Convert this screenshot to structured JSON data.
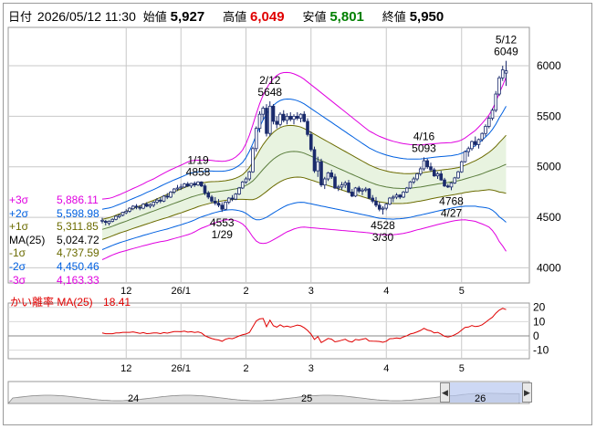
{
  "header": {
    "date_label": "日付",
    "datetime": "2026/05/12 11:30",
    "open_label": "始値",
    "open_value": "5,927",
    "high_label": "高値",
    "high_value": "6,049",
    "low_label": "安値",
    "low_value": "5,801",
    "close_label": "終値",
    "close_value": "5,950",
    "colors": {
      "high": "#e00000",
      "low": "#008000",
      "text": "#000000"
    }
  },
  "bb_legend": [
    {
      "label": "+3σ",
      "value": "5,886.11",
      "color": "#e000e0"
    },
    {
      "label": "+2σ",
      "value": "5,598.98",
      "color": "#0060e0"
    },
    {
      "label": "+1σ",
      "value": "5,311.85",
      "color": "#6b6b00"
    },
    {
      "label": "MA(25)",
      "value": "5,024.72",
      "color": "#000000"
    },
    {
      "label": "-1σ",
      "value": "4,737.59",
      "color": "#6b6b00"
    },
    {
      "label": "-2σ",
      "value": "4,450.46",
      "color": "#0060e0"
    },
    {
      "label": "-3σ",
      "value": "4,163.33",
      "color": "#e000e0"
    }
  ],
  "divergence": {
    "label": "かい離率 MA(25)",
    "value": "18.41",
    "color": "#e00000"
  },
  "navigator_icons": [
    "scroll-left-icon",
    "scroll-right-icon"
  ],
  "chart_data": [
    {
      "type": "candlestick",
      "title": "",
      "y_ticks": [
        4000,
        4500,
        5000,
        5500,
        6000
      ],
      "ylim": [
        3850,
        6380
      ],
      "x_tick_labels": [
        "12",
        "26/1",
        "2",
        "3",
        "4",
        "5"
      ],
      "x_tick_bar_index": [
        7,
        23,
        42,
        61,
        83,
        105
      ],
      "grid": true,
      "annotations": [
        {
          "text": "1/19",
          "value": 4858,
          "bar": 28,
          "position": "above"
        },
        {
          "text": "4553 1/29",
          "value": 4553,
          "bar": 35,
          "position": "below"
        },
        {
          "text": "2/12",
          "value": 5648,
          "bar": 49,
          "position": "above"
        },
        {
          "text": "4528 3/30",
          "value": 4528,
          "bar": 82,
          "position": "below"
        },
        {
          "text": "4/16",
          "value": 5093,
          "bar": 94,
          "position": "above"
        },
        {
          "text": "4768 4/27",
          "value": 4768,
          "bar": 102,
          "position": "below"
        },
        {
          "text": "5/12",
          "value": 6049,
          "bar": 118,
          "position": "above"
        }
      ],
      "ohlc": [
        [
          4470,
          4495,
          4440,
          4470
        ],
        [
          4460,
          4475,
          4420,
          4450
        ],
        [
          4440,
          4470,
          4420,
          4460
        ],
        [
          4460,
          4490,
          4450,
          4480
        ],
        [
          4480,
          4520,
          4470,
          4510
        ],
        [
          4505,
          4530,
          4490,
          4520
        ],
        [
          4520,
          4555,
          4510,
          4550
        ],
        [
          4545,
          4580,
          4530,
          4560
        ],
        [
          4560,
          4600,
          4545,
          4590
        ],
        [
          4585,
          4620,
          4570,
          4610
        ],
        [
          4610,
          4630,
          4580,
          4600
        ],
        [
          4600,
          4620,
          4570,
          4590
        ],
        [
          4590,
          4640,
          4580,
          4630
        ],
        [
          4630,
          4650,
          4600,
          4610
        ],
        [
          4610,
          4640,
          4590,
          4625
        ],
        [
          4620,
          4660,
          4600,
          4650
        ],
        [
          4650,
          4690,
          4630,
          4670
        ],
        [
          4670,
          4700,
          4640,
          4660
        ],
        [
          4660,
          4720,
          4650,
          4710
        ],
        [
          4710,
          4740,
          4680,
          4700
        ],
        [
          4700,
          4760,
          4690,
          4750
        ],
        [
          4750,
          4790,
          4730,
          4780
        ],
        [
          4780,
          4820,
          4760,
          4790
        ],
        [
          4790,
          4830,
          4770,
          4800
        ],
        [
          4800,
          4840,
          4790,
          4830
        ],
        [
          4830,
          4850,
          4800,
          4810
        ],
        [
          4810,
          4840,
          4790,
          4835
        ],
        [
          4835,
          4855,
          4800,
          4820
        ],
        [
          4820,
          4858,
          4810,
          4850
        ],
        [
          4850,
          4856,
          4800,
          4810
        ],
        [
          4810,
          4830,
          4720,
          4740
        ],
        [
          4740,
          4760,
          4680,
          4700
        ],
        [
          4700,
          4720,
          4640,
          4660
        ],
        [
          4660,
          4700,
          4620,
          4640
        ],
        [
          4640,
          4680,
          4600,
          4620
        ],
        [
          4620,
          4650,
          4553,
          4580
        ],
        [
          4580,
          4660,
          4570,
          4650
        ],
        [
          4650,
          4700,
          4630,
          4690
        ],
        [
          4690,
          4720,
          4660,
          4680
        ],
        [
          4680,
          4740,
          4670,
          4730
        ],
        [
          4730,
          4800,
          4720,
          4790
        ],
        [
          4790,
          4860,
          4780,
          4850
        ],
        [
          4850,
          4900,
          4830,
          4880
        ],
        [
          4880,
          4960,
          4860,
          4950
        ],
        [
          4950,
          5200,
          4940,
          5180
        ],
        [
          5180,
          5400,
          5150,
          5380
        ],
        [
          5380,
          5550,
          5340,
          5520
        ],
        [
          5520,
          5600,
          5460,
          5580
        ],
        [
          5580,
          5620,
          5300,
          5330
        ],
        [
          5330,
          5648,
          5300,
          5600
        ],
        [
          5600,
          5620,
          5420,
          5450
        ],
        [
          5450,
          5500,
          5380,
          5420
        ],
        [
          5420,
          5540,
          5400,
          5520
        ],
        [
          5520,
          5560,
          5440,
          5460
        ],
        [
          5460,
          5530,
          5420,
          5500
        ],
        [
          5500,
          5540,
          5450,
          5470
        ],
        [
          5470,
          5520,
          5420,
          5500
        ],
        [
          5500,
          5540,
          5460,
          5480
        ],
        [
          5480,
          5530,
          5440,
          5520
        ],
        [
          5520,
          5550,
          5440,
          5450
        ],
        [
          5450,
          5480,
          5300,
          5320
        ],
        [
          5320,
          5350,
          5150,
          5170
        ],
        [
          5170,
          5200,
          4940,
          4960
        ],
        [
          4960,
          5100,
          4900,
          5050
        ],
        [
          5050,
          5080,
          4800,
          4820
        ],
        [
          4820,
          4900,
          4780,
          4880
        ],
        [
          4880,
          4950,
          4860,
          4940
        ],
        [
          4940,
          4970,
          4880,
          4900
        ],
        [
          4900,
          4930,
          4780,
          4790
        ],
        [
          4790,
          4820,
          4760,
          4800
        ],
        [
          4800,
          4850,
          4770,
          4820
        ],
        [
          4820,
          4860,
          4790,
          4840
        ],
        [
          4840,
          4870,
          4740,
          4750
        ],
        [
          4750,
          4780,
          4700,
          4710
        ],
        [
          4710,
          4800,
          4700,
          4790
        ],
        [
          4790,
          4810,
          4740,
          4760
        ],
        [
          4760,
          4790,
          4720,
          4770
        ],
        [
          4770,
          4800,
          4750,
          4780
        ],
        [
          4780,
          4790,
          4680,
          4690
        ],
        [
          4690,
          4720,
          4640,
          4660
        ],
        [
          4660,
          4700,
          4600,
          4620
        ],
        [
          4620,
          4650,
          4560,
          4580
        ],
        [
          4580,
          4610,
          4528,
          4590
        ],
        [
          4590,
          4640,
          4570,
          4630
        ],
        [
          4630,
          4700,
          4620,
          4690
        ],
        [
          4690,
          4720,
          4650,
          4700
        ],
        [
          4700,
          4740,
          4680,
          4720
        ],
        [
          4720,
          4730,
          4680,
          4700
        ],
        [
          4700,
          4760,
          4690,
          4750
        ],
        [
          4750,
          4800,
          4740,
          4790
        ],
        [
          4790,
          4860,
          4780,
          4850
        ],
        [
          4850,
          4900,
          4830,
          4880
        ],
        [
          4880,
          4940,
          4860,
          4930
        ],
        [
          4930,
          5000,
          4910,
          4980
        ],
        [
          4980,
          5093,
          4960,
          5060
        ],
        [
          5060,
          5080,
          4980,
          5000
        ],
        [
          5000,
          5040,
          4950,
          4970
        ],
        [
          4970,
          4990,
          4900,
          4910
        ],
        [
          4910,
          4950,
          4880,
          4930
        ],
        [
          4930,
          4960,
          4860,
          4870
        ],
        [
          4870,
          4890,
          4800,
          4810
        ],
        [
          4810,
          4830,
          4790,
          4800
        ],
        [
          4800,
          4850,
          4768,
          4840
        ],
        [
          4840,
          4900,
          4830,
          4890
        ],
        [
          4890,
          4960,
          4880,
          4950
        ],
        [
          4950,
          5060,
          4940,
          5050
        ],
        [
          5050,
          5160,
          5040,
          5150
        ],
        [
          5150,
          5200,
          5100,
          5180
        ],
        [
          5180,
          5260,
          5160,
          5250
        ],
        [
          5250,
          5300,
          5200,
          5220
        ],
        [
          5220,
          5280,
          5180,
          5270
        ],
        [
          5270,
          5340,
          5250,
          5330
        ],
        [
          5330,
          5420,
          5300,
          5400
        ],
        [
          5400,
          5500,
          5380,
          5480
        ],
        [
          5480,
          5580,
          5460,
          5560
        ],
        [
          5560,
          5750,
          5540,
          5720
        ],
        [
          5720,
          5900,
          5700,
          5880
        ],
        [
          5880,
          6000,
          5850,
          5960
        ],
        [
          5927,
          6049,
          5801,
          5950
        ]
      ],
      "bollinger": {
        "ma25": [
          4380,
          4390,
          4400,
          4412,
          4425,
          4438,
          4450,
          4462,
          4475,
          4488,
          4500,
          4512,
          4525,
          4538,
          4550,
          4562,
          4575,
          4588,
          4600,
          4612,
          4625,
          4638,
          4650,
          4662,
          4675,
          4688,
          4700,
          4710,
          4720,
          4728,
          4735,
          4742,
          4748,
          4752,
          4756,
          4760,
          4765,
          4770,
          4776,
          4782,
          4790,
          4800,
          4815,
          4835,
          4860,
          4895,
          4935,
          4975,
          5010,
          5045,
          5075,
          5100,
          5120,
          5135,
          5145,
          5150,
          5152,
          5150,
          5145,
          5135,
          5120,
          5105,
          5090,
          5075,
          5060,
          5045,
          5030,
          5015,
          5000,
          4985,
          4970,
          4955,
          4940,
          4925,
          4910,
          4895,
          4880,
          4865,
          4850,
          4838,
          4825,
          4815,
          4808,
          4800,
          4795,
          4790,
          4788,
          4786,
          4785,
          4786,
          4788,
          4792,
          4796,
          4800,
          4806,
          4812,
          4818,
          4824,
          4830,
          4835,
          4840,
          4845,
          4850,
          4856,
          4862,
          4870,
          4880,
          4890,
          4900,
          4910,
          4920,
          4932,
          4945,
          4958,
          4970,
          4982,
          4995,
          5010,
          5024.72
        ],
        "sd": [
          100,
          98,
          96,
          95,
          95,
          95,
          96,
          97,
          98,
          99,
          100,
          101,
          102,
          104,
          105,
          106,
          108,
          110,
          112,
          114,
          115,
          116,
          117,
          118,
          119,
          120,
          120,
          118,
          115,
          112,
          110,
          108,
          105,
          102,
          100,
          98,
          97,
          98,
          100,
          105,
          112,
          122,
          138,
          160,
          185,
          210,
          230,
          245,
          255,
          262,
          266,
          268,
          268,
          266,
          263,
          260,
          256,
          252,
          248,
          244,
          240,
          236,
          232,
          228,
          224,
          220,
          216,
          212,
          208,
          204,
          200,
          196,
          192,
          188,
          184,
          180,
          176,
          172,
          168,
          166,
          164,
          162,
          160,
          158,
          156,
          154,
          152,
          150,
          148,
          146,
          144,
          142,
          140,
          139,
          138,
          137,
          136,
          135,
          134,
          133,
          132,
          131,
          130,
          130,
          130,
          132,
          135,
          140,
          145,
          150,
          158,
          166,
          175,
          185,
          200,
          220,
          245,
          265,
          287.13
        ]
      }
    },
    {
      "type": "line",
      "title": "かい離率 MA(25)",
      "y_ticks": [
        -10,
        0,
        10,
        20
      ],
      "ylim": [
        -16,
        23
      ],
      "zero_line": true,
      "series": [
        {
          "name": "かい離率",
          "color": "#e00000",
          "values": [
            2,
            1.5,
            1.5,
            1.5,
            2,
            2,
            2.5,
            2.5,
            2.5,
            2.8,
            2.3,
            1.8,
            2.3,
            1.6,
            1.7,
            2,
            2.1,
            1.6,
            2.3,
            1.9,
            2.5,
            3,
            3,
            2.9,
            3.3,
            2.6,
            2.9,
            2.4,
            2.8,
            2,
            0.1,
            -1,
            -1.9,
            -2.5,
            -2.9,
            -3.8,
            -2.4,
            -1.7,
            -2,
            -1.1,
            0,
            0.8,
            1.3,
            2.4,
            6.4,
            10.5,
            11.9,
            12.2,
            6.4,
            11,
            7.1,
            6.1,
            7.8,
            6.3,
            6.8,
            6.2,
            6.8,
            7.6,
            7.1,
            5.7,
            3.8,
            1.2,
            -2.5,
            -0.5,
            -4.7,
            -3.3,
            -1.8,
            -2.3,
            -4.2,
            -3.7,
            -3,
            -2.4,
            -3.8,
            -4.3,
            -2.5,
            -2.9,
            -2.3,
            -1.8,
            -3.6,
            -3.7,
            -3.8,
            -3.9,
            -4.5,
            -3.7,
            -2,
            -1.9,
            -1.4,
            -1.8,
            -0.7,
            0.1,
            1.3,
            1.9,
            2.8,
            3.8,
            5.3,
            4.1,
            3.5,
            2.1,
            2.5,
            1.2,
            -0.3,
            -0.8,
            -0.2,
            0.8,
            2.1,
            4.1,
            5.9,
            6.2,
            7.3,
            6.5,
            6.8,
            7.8,
            9.5,
            11.4,
            13,
            15.9,
            18,
            19.3,
            18.41
          ]
        }
      ]
    },
    {
      "type": "area",
      "title": "",
      "x_tick_labels": [
        "24",
        "25",
        "26"
      ],
      "grid": false
    }
  ]
}
